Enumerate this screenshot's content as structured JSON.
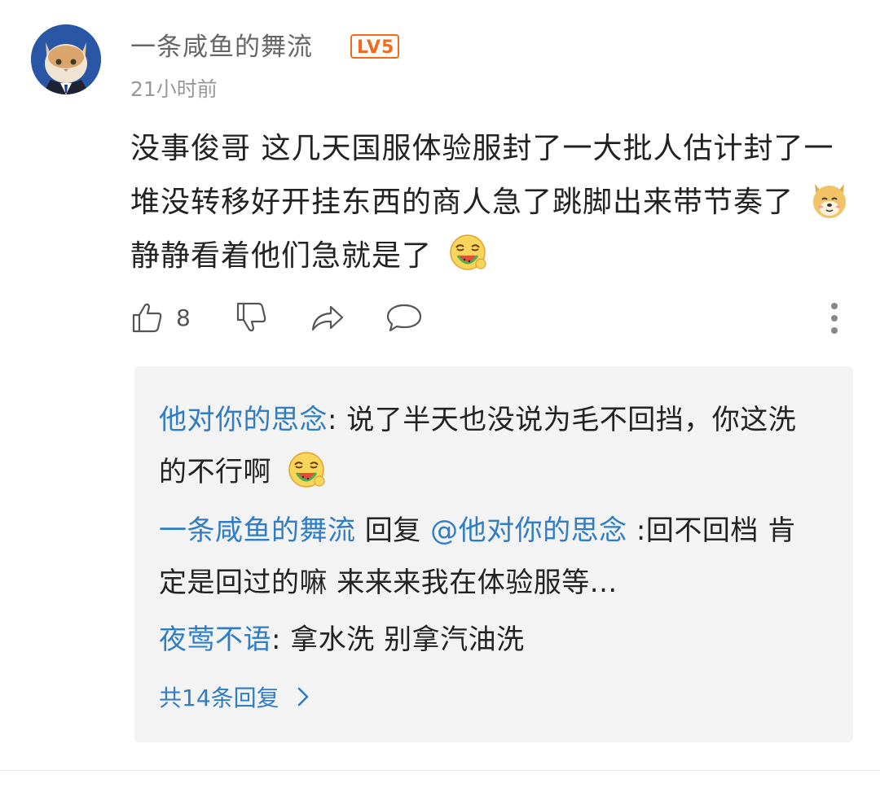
{
  "comment": {
    "username": "一条咸鱼的舞流",
    "level": "LV5",
    "time": "21小时前",
    "text_part1": "没事俊哥  这几天国服体验服封了一大批人估计封了一堆没转移好开挂东西的商人急了跳脚出来带节奏了",
    "text_part2": "    静静看着他们急就是了",
    "emoji1": "doge-emoji",
    "emoji2": "eating-watermelon-emoji",
    "likes": "8"
  },
  "replies": [
    {
      "author": "他对你的思念",
      "separator": ":",
      "text": " 说了半天也没说为毛不回挡，你这洗的不行啊"
    },
    {
      "author": "一条咸鱼的舞流",
      "mid": " 回复 ",
      "mention": "@他对你的思念",
      "text": " :回不回档  肯定是回过的嘛    来来来我在体验服等..."
    },
    {
      "author": "夜莺不语",
      "separator": ":",
      "text": " 拿水洗 别拿汽油洗"
    }
  ],
  "more_replies_label": "共14条回复",
  "colors": {
    "link": "#2f7dc4",
    "badge": "#f26b1d",
    "reply_bg": "#f3f3f3"
  }
}
